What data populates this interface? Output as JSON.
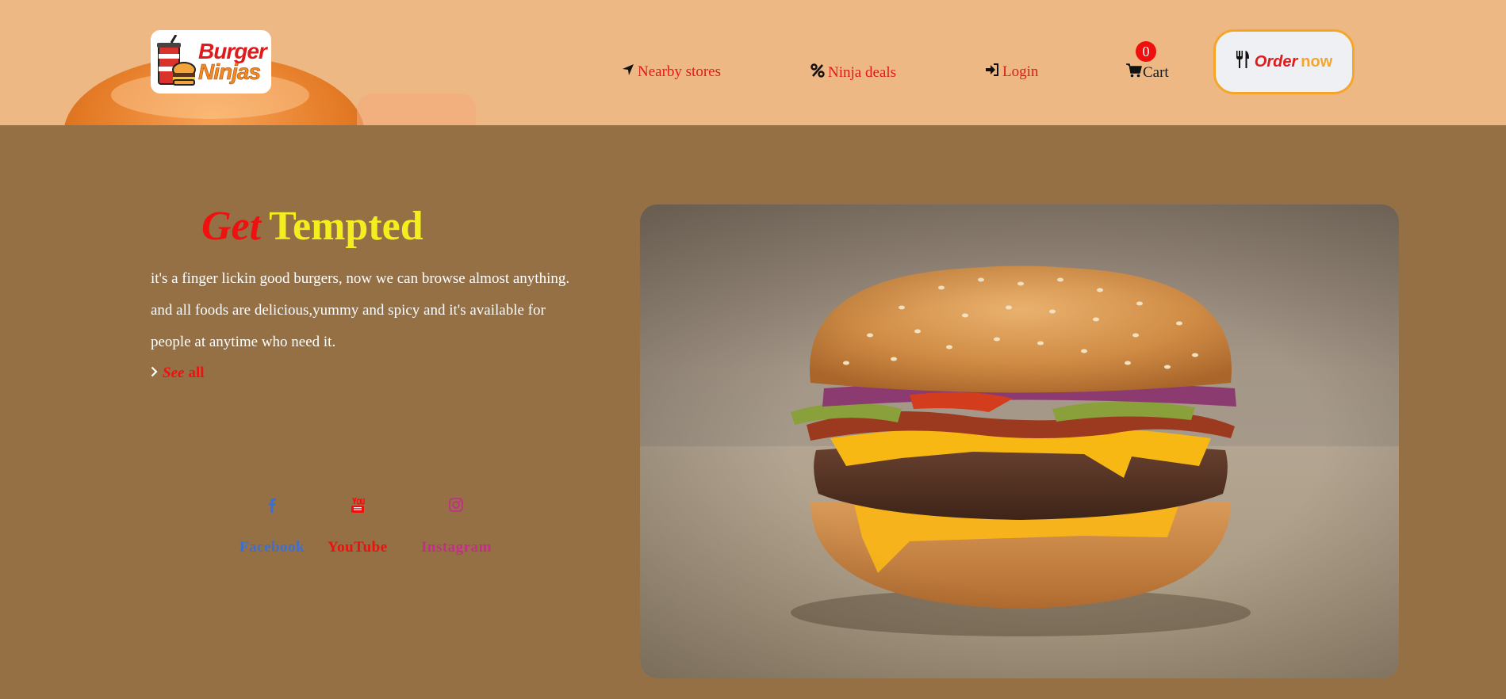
{
  "brand": {
    "logo_line1": "Burger",
    "logo_line2": "Ninjas"
  },
  "nav": {
    "nearby_stores": "Nearby stores",
    "ninja_deals": "Ninja deals",
    "login": "Login",
    "cart": "Cart",
    "cart_count": "0",
    "order_now_1": "Order",
    "order_now_2": "now"
  },
  "hero": {
    "title_word1": "Get",
    "title_word2": "Tempted",
    "lines": [
      "it's a finger lickin good burgers, now we can browse almost anything.",
      "and all foods are delicious,yummy and spicy and it's available for",
      "people at anytime who need it."
    ],
    "see_all_1": "See",
    "see_all_2": "all"
  },
  "social": {
    "facebook": "Facebook",
    "youtube": "YouTube",
    "instagram": "Instagram"
  },
  "colors": {
    "header_bg": "#eeb885",
    "page_bg": "#957045",
    "accent_red": "#e21919",
    "accent_orange": "#f5a62a",
    "title_yellow": "#f3ee1d",
    "facebook_blue": "#3b6fd4",
    "youtube_red": "#ee0f0f",
    "instagram_pink": "#c12f87"
  },
  "icons": {
    "nearby": "location-arrow-icon",
    "deals": "percent-icon",
    "login": "sign-in-icon",
    "cart": "shopping-cart-icon",
    "order": "utensils-icon",
    "see_all": "chevron-right-icon",
    "facebook": "facebook-icon",
    "youtube": "youtube-icon",
    "instagram": "instagram-icon"
  }
}
